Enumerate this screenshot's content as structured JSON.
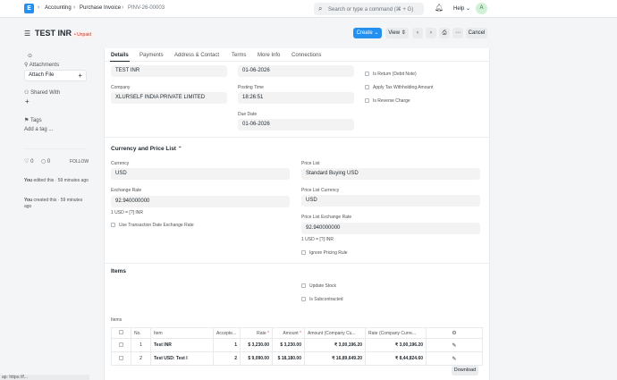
{
  "nav": {
    "logo": "E",
    "breadcrumbs": [
      "Accounting",
      "Purchase Invoice",
      "PINV-26-00003"
    ],
    "search_placeholder": "Search or type a command (⌘ + G)",
    "help": "Help",
    "avatar": "A"
  },
  "header": {
    "title": "TEST INR",
    "status": "Unpaid",
    "create": "Create",
    "view": "View",
    "cancel": "Cancel"
  },
  "sidebar": {
    "attachments": "Attachments",
    "attach_file": "Attach File",
    "shared_with": "Shared With",
    "tags": "Tags",
    "add_tag": "Add a tag ...",
    "likes": "0",
    "comments": "0",
    "follow": "FOLLOW",
    "activity": [
      {
        "user": "You",
        "text": "edited this · 59 minutes ago"
      },
      {
        "user": "You",
        "text": "created this · 59 minutes ago"
      }
    ]
  },
  "tabs": [
    "Details",
    "Payments",
    "Address & Contact",
    "Terms",
    "More Info",
    "Connections"
  ],
  "details": {
    "supplier_value": "TEST INR",
    "posting_date_value": "01-06-2026",
    "company_label": "Company",
    "company_value": "XLURSELF INDIA PRIVATE LIMITED",
    "posting_time_label": "Posting Time",
    "posting_time_value": "18:26:51",
    "due_date_label": "Due Date",
    "due_date_value": "01-06-2026",
    "checks": [
      "Is Return (Debit Note)",
      "Apply Tax Withholding Amount",
      "Is Reverse Charge"
    ]
  },
  "currency": {
    "section": "Currency and Price List",
    "currency_label": "Currency",
    "currency_value": "USD",
    "exchange_rate_label": "Exchange Rate",
    "exchange_rate_value": "92.940000000",
    "exchange_note": "1 USD = [?] INR",
    "use_txn_rate": "Use Transaction Date Exchange Rate",
    "price_list_label": "Price List",
    "price_list_value": "Standard Buying USD",
    "pl_currency_label": "Price List Currency",
    "pl_currency_value": "USD",
    "pl_rate_label": "Price List Exchange Rate",
    "pl_rate_value": "92.940000000",
    "pl_note": "1 USD = [?] INR",
    "ignore_pricing": "Ignore Pricing Rule"
  },
  "items_section": {
    "title": "Items",
    "update_stock": "Update Stock",
    "is_subcontracted": "Is Subcontracted",
    "table_label": "Items",
    "columns": [
      "No.",
      "Item",
      "Accepte...",
      "Rate",
      "Amount",
      "Amount (Company Cu...",
      "Rate (Company Curre..."
    ],
    "rows": [
      {
        "no": "1",
        "item": "Test INR",
        "qty": "1",
        "rate": "$ 3,230.00",
        "amount": "$ 3,230.00",
        "amount_company": "₹ 3,00,196.20",
        "rate_company": "₹ 3,00,196.20"
      },
      {
        "no": "2",
        "item": "Test USD: Test I",
        "qty": "2",
        "rate": "$ 9,090.00",
        "amount": "$ 18,180.00",
        "amount_company": "₹ 16,89,649.20",
        "rate_company": "₹ 8,44,824.60"
      }
    ],
    "download": "Download"
  },
  "statusbar": "ap: https://f..."
}
